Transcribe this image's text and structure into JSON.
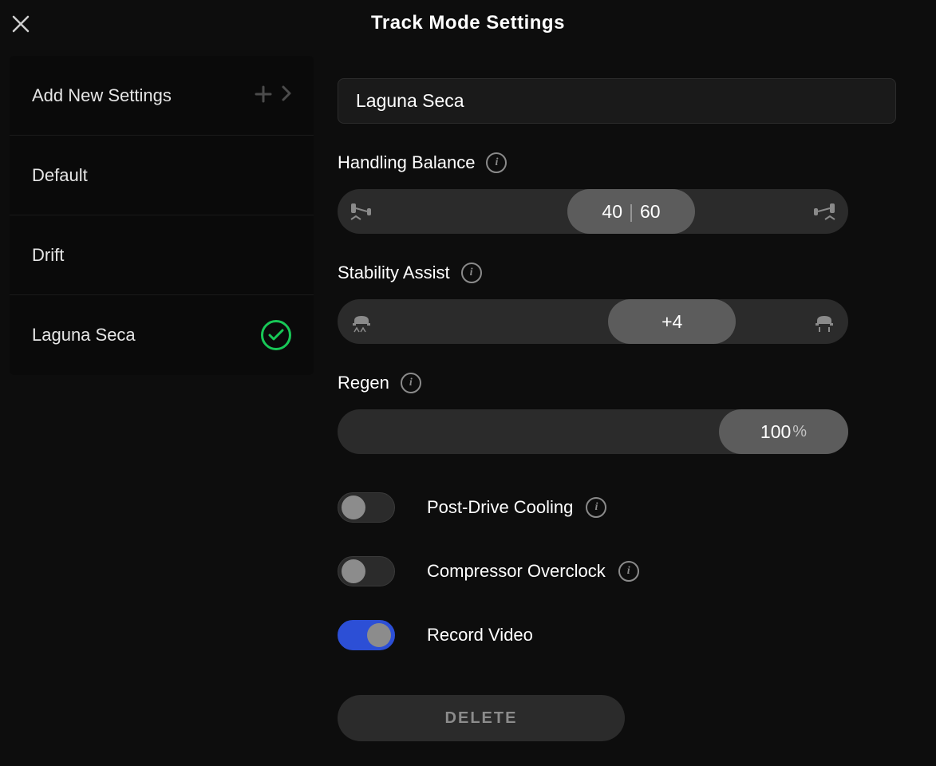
{
  "title": "Track Mode Settings",
  "sidebar": {
    "add_label": "Add New Settings",
    "items": [
      {
        "label": "Default",
        "selected": false
      },
      {
        "label": "Drift",
        "selected": false
      },
      {
        "label": "Laguna Seca",
        "selected": true
      }
    ]
  },
  "main": {
    "profile_name": "Laguna Seca",
    "handling_balance": {
      "label": "Handling Balance",
      "front": "40",
      "rear": "60",
      "thumb_left_pct": 45
    },
    "stability_assist": {
      "label": "Stability Assist",
      "value": "+4",
      "thumb_left_pct": 53
    },
    "regen": {
      "label": "Regen",
      "value": "100",
      "unit": "%"
    },
    "toggles": {
      "post_drive_cooling": {
        "label": "Post-Drive Cooling",
        "on": false
      },
      "compressor_overclock": {
        "label": "Compressor Overclock",
        "on": false
      },
      "record_video": {
        "label": "Record Video",
        "on": true
      }
    },
    "delete_label": "DELETE"
  }
}
